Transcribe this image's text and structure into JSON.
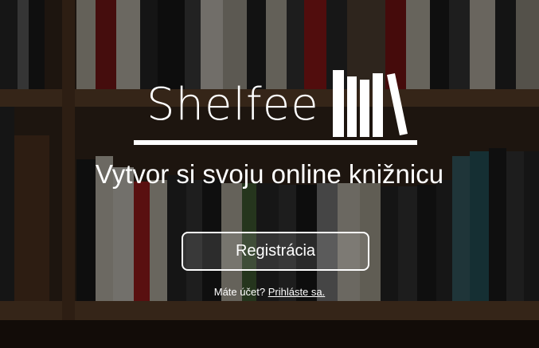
{
  "logo": {
    "text": "Shelfee"
  },
  "hero": {
    "tagline": "Vytvor si svoju online knižnicu",
    "register_label": "Registrácia",
    "login_prompt": "Máte účet?",
    "login_link": "Prihláste sa."
  },
  "colors": {
    "text": "#ffffff",
    "overlay": "rgba(0,0,0,0.50)"
  }
}
